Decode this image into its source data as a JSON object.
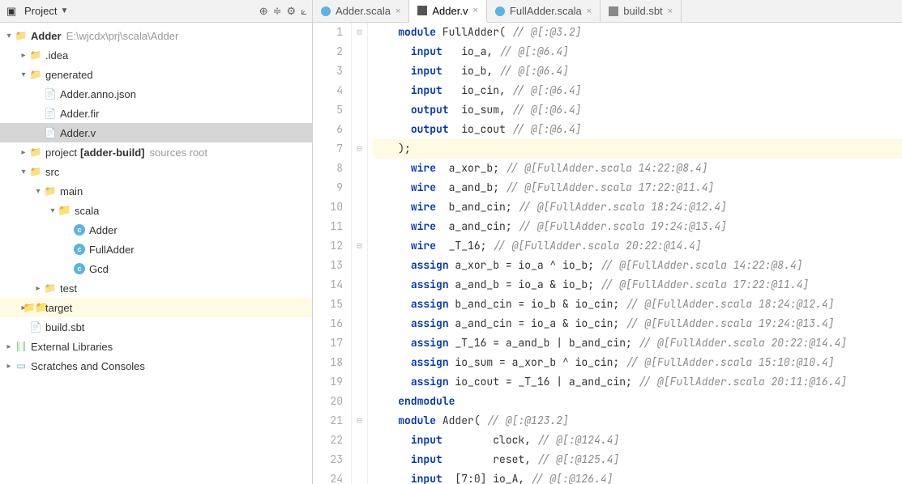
{
  "sidebar": {
    "title": "Project",
    "toolbar_icons": [
      "target",
      "tree-options",
      "gear",
      "collapse"
    ],
    "tree": {
      "root": {
        "name": "Adder",
        "path": "E:\\wjcdx\\prj\\scala\\Adder"
      },
      "idea": ".idea",
      "generated": "generated",
      "gen_children": [
        "Adder.anno.json",
        "Adder.fir",
        "Adder.v"
      ],
      "project": {
        "label": "project",
        "build": "[adder-build]",
        "hint": "sources root"
      },
      "src": "src",
      "main": "main",
      "scala": "scala",
      "scala_children": [
        "Adder",
        "FullAdder",
        "Gcd"
      ],
      "test": "test",
      "target": "target",
      "build_sbt": "build.sbt",
      "external": "External Libraries",
      "scratches": "Scratches and Consoles"
    }
  },
  "tabs": [
    {
      "label": "Adder.scala",
      "type": "scala",
      "active": false
    },
    {
      "label": "Adder.v",
      "type": "v",
      "active": true
    },
    {
      "label": "FullAdder.scala",
      "type": "scala",
      "active": false
    },
    {
      "label": "build.sbt",
      "type": "sbt",
      "active": false
    }
  ],
  "code": {
    "lines": [
      {
        "n": 1,
        "pre": "    ",
        "tokens": [
          [
            "kw",
            "module"
          ],
          [
            "id",
            " FullAdder( "
          ],
          [
            "cm",
            "// @[:@3.2]"
          ]
        ]
      },
      {
        "n": 2,
        "pre": "      ",
        "tokens": [
          [
            "kw",
            "input"
          ],
          [
            "id",
            "   io_a, "
          ],
          [
            "cm",
            "// @[:@6.4]"
          ]
        ]
      },
      {
        "n": 3,
        "pre": "      ",
        "tokens": [
          [
            "kw",
            "input"
          ],
          [
            "id",
            "   io_b, "
          ],
          [
            "cm",
            "// @[:@6.4]"
          ]
        ]
      },
      {
        "n": 4,
        "pre": "      ",
        "tokens": [
          [
            "kw",
            "input"
          ],
          [
            "id",
            "   io_cin, "
          ],
          [
            "cm",
            "// @[:@6.4]"
          ]
        ]
      },
      {
        "n": 5,
        "pre": "      ",
        "tokens": [
          [
            "kw",
            "output"
          ],
          [
            "id",
            "  io_sum, "
          ],
          [
            "cm",
            "// @[:@6.4]"
          ]
        ]
      },
      {
        "n": 6,
        "pre": "      ",
        "tokens": [
          [
            "kw",
            "output"
          ],
          [
            "id",
            "  io_cout "
          ],
          [
            "cm",
            "// @[:@6.4]"
          ]
        ]
      },
      {
        "n": 7,
        "pre": "    ",
        "hl": true,
        "tokens": [
          [
            "id",
            ");"
          ]
        ]
      },
      {
        "n": 8,
        "pre": "      ",
        "tokens": [
          [
            "kw",
            "wire"
          ],
          [
            "id",
            "  a_xor_b; "
          ],
          [
            "cm",
            "// @[FullAdder.scala 14:22:@8.4]"
          ]
        ]
      },
      {
        "n": 9,
        "pre": "      ",
        "tokens": [
          [
            "kw",
            "wire"
          ],
          [
            "id",
            "  a_and_b; "
          ],
          [
            "cm",
            "// @[FullAdder.scala 17:22:@11.4]"
          ]
        ]
      },
      {
        "n": 10,
        "pre": "      ",
        "tokens": [
          [
            "kw",
            "wire"
          ],
          [
            "id",
            "  b_and_cin; "
          ],
          [
            "cm",
            "// @[FullAdder.scala 18:24:@12.4]"
          ]
        ]
      },
      {
        "n": 11,
        "pre": "      ",
        "tokens": [
          [
            "kw",
            "wire"
          ],
          [
            "id",
            "  a_and_cin; "
          ],
          [
            "cm",
            "// @[FullAdder.scala 19:24:@13.4]"
          ]
        ]
      },
      {
        "n": 12,
        "pre": "      ",
        "tokens": [
          [
            "kw",
            "wire"
          ],
          [
            "id",
            "  _T_16; "
          ],
          [
            "cm",
            "// @[FullAdder.scala 20:22:@14.4]"
          ]
        ]
      },
      {
        "n": 13,
        "pre": "      ",
        "tokens": [
          [
            "kw",
            "assign"
          ],
          [
            "id",
            " a_xor_b = io_a ^ io_b; "
          ],
          [
            "cm",
            "// @[FullAdder.scala 14:22:@8.4]"
          ]
        ]
      },
      {
        "n": 14,
        "pre": "      ",
        "tokens": [
          [
            "kw",
            "assign"
          ],
          [
            "id",
            " a_and_b = io_a & io_b; "
          ],
          [
            "cm",
            "// @[FullAdder.scala 17:22:@11.4]"
          ]
        ]
      },
      {
        "n": 15,
        "pre": "      ",
        "tokens": [
          [
            "kw",
            "assign"
          ],
          [
            "id",
            " b_and_cin = io_b & io_cin; "
          ],
          [
            "cm",
            "// @[FullAdder.scala 18:24:@12.4]"
          ]
        ]
      },
      {
        "n": 16,
        "pre": "      ",
        "tokens": [
          [
            "kw",
            "assign"
          ],
          [
            "id",
            " a_and_cin = io_a & io_cin; "
          ],
          [
            "cm",
            "// @[FullAdder.scala 19:24:@13.4]"
          ]
        ]
      },
      {
        "n": 17,
        "pre": "      ",
        "tokens": [
          [
            "kw",
            "assign"
          ],
          [
            "id",
            " _T_16 = a_and_b | b_and_cin; "
          ],
          [
            "cm",
            "// @[FullAdder.scala 20:22:@14.4]"
          ]
        ]
      },
      {
        "n": 18,
        "pre": "      ",
        "tokens": [
          [
            "kw",
            "assign"
          ],
          [
            "id",
            " io_sum = a_xor_b ^ io_cin; "
          ],
          [
            "cm",
            "// @[FullAdder.scala 15:10:@10.4]"
          ]
        ]
      },
      {
        "n": 19,
        "pre": "      ",
        "tokens": [
          [
            "kw",
            "assign"
          ],
          [
            "id",
            " io_cout = _T_16 | a_and_cin; "
          ],
          [
            "cm",
            "// @[FullAdder.scala 20:11:@16.4]"
          ]
        ]
      },
      {
        "n": 20,
        "pre": "    ",
        "tokens": [
          [
            "kw",
            "endmodule"
          ]
        ]
      },
      {
        "n": 21,
        "pre": "    ",
        "tokens": [
          [
            "kw",
            "module"
          ],
          [
            "id",
            " Adder( "
          ],
          [
            "cm",
            "// @[:@123.2]"
          ]
        ]
      },
      {
        "n": 22,
        "pre": "      ",
        "tokens": [
          [
            "kw",
            "input"
          ],
          [
            "id",
            "        clock, "
          ],
          [
            "cm",
            "// @[:@124.4]"
          ]
        ]
      },
      {
        "n": 23,
        "pre": "      ",
        "tokens": [
          [
            "kw",
            "input"
          ],
          [
            "id",
            "        reset, "
          ],
          [
            "cm",
            "// @[:@125.4]"
          ]
        ]
      },
      {
        "n": 24,
        "pre": "      ",
        "tokens": [
          [
            "kw",
            "input"
          ],
          [
            "id",
            "  [7:0] io_A, "
          ],
          [
            "cm",
            "// @[:@126.4]"
          ]
        ]
      }
    ],
    "fold_markers": {
      "1": "⊟",
      "7": "⊟",
      "12": "⊟",
      "21": "⊟"
    }
  }
}
